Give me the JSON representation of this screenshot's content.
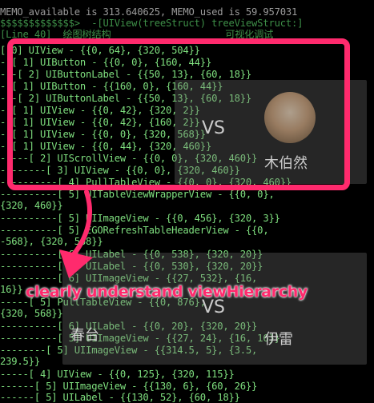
{
  "console": {
    "status_line": "MEMO_available is 313.640625, MEMO_used is 59.957031",
    "lines": [
      "$$$$$$$$$$$$$>  -[UIView(treeStruct) treeViewStruct:]",
      "[Line 40]  绘图树结构                    可视化调试",
      "[ 0] UIView - {{0, 64}, {320, 504}}",
      "--[ 1] UIButton - {{0, 0}, {160, 44}}",
      "---[ 2] UIButtonLabel - {{50, 13}, {60, 18}}",
      "--[ 1] UIButton - {{160, 0}, {160, 44}}",
      "---[ 2] UIButtonLabel - {{50, 13}, {60, 18}}",
      "--[ 1] UIView - {{0, 42}, {320, 2}}",
      "--[ 1] UIView - {{0, 42}, {160, 2}}",
      "--[ 1] UIView - {{0, 0}, {320, 568}}",
      "--[ 1] UIView - {{0, 44}, {320, 460}}",
      "-----[ 2] UIScrollView - {{0, 0}, {320, 460}}",
      "--------[ 3] UIView - {{0, 0}, {320, 460}}",
      "----------[ 4] PullTableView - {{0, 0}, {320, 460}}",
      "----------[ 5] UITableViewWrapperView - {{0, 0},",
      "{320, 460}}",
      "",
      "----------[ 5] UIImageView - {{0, 456}, {320, 3}}",
      "----------[ 5] EGORefreshTableHeaderView - {{0,",
      "-568}, {320, 568}}",
      "",
      "----------[ 6] UILabel - {{0, 538}, {320, 20}}",
      "----------[ 6] UILabel - {{0, 530}, {320, 20}}",
      "----------[ 6] UIImageView - {{27, 532}, {16,",
      "16}}",
      "-----[ 5] PullTableView - {{0, 876},",
      "{320, 568}}",
      "",
      "----------[ 6] UILabel - {{0, 20}, {320, 20}}",
      "----------[ 5] UIImageView - {{27, 24}, {16, 16}}",
      "--------[ 5] UIImageView - {{314.5, 5}, {3.5,",
      "239.5}}",
      "",
      "-----[ 4] UIView - {{0, 125}, {320, 115}}",
      "------[ 5] UIImageView - {{130, 6}, {60, 26}}",
      "------[ 5] UILabel - {{130, 52}, {60, 18}}"
    ]
  },
  "annotation": {
    "text": "clearly understand viewHierarchy",
    "color": "#ff2a6d"
  },
  "ghost_app": {
    "name_1": "木伯然",
    "name_2": "春台",
    "name_3": "伊雷",
    "vs": "VS"
  }
}
